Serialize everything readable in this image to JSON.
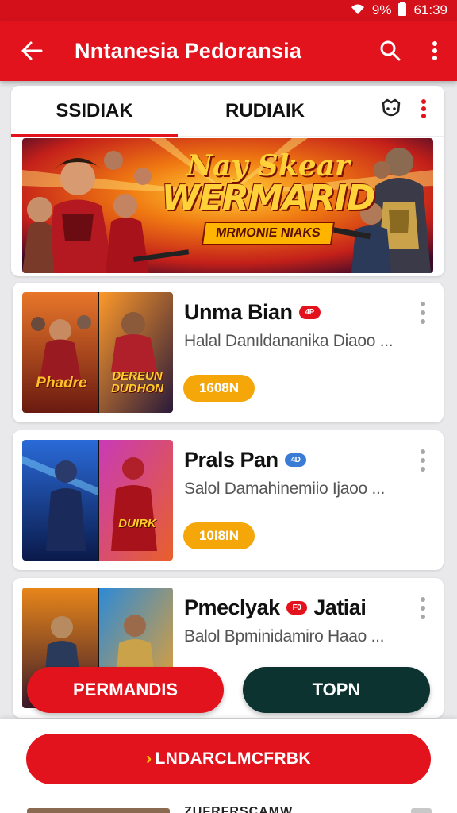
{
  "status_bar": {
    "battery": "9%",
    "time": "61:39"
  },
  "app_bar": {
    "title": "Nntanesia Pedoransia"
  },
  "tabs": [
    {
      "label": "SSIDIAK"
    },
    {
      "label": "RUDIAIK"
    }
  ],
  "banner": {
    "subtitle": "Nay Skear",
    "title": "WERMARID",
    "tagline": "MRMONIE NIAKS"
  },
  "games": [
    {
      "name": "Unma Bian",
      "badge": "4P",
      "badge_color": "#e3131e",
      "description": "Halal Danıldananika Diaoo ...",
      "price": "1608N",
      "thumb_right_label": "DEREUN DUDHON",
      "thumb_left_label": "Phadre"
    },
    {
      "name": "Prals Pan",
      "badge": "4D",
      "badge_color": "#3a7bd5",
      "description": "Salol Damahinemiio  Ijaoo ...",
      "price": "10I8IN",
      "thumb_right_label": "DUIRK",
      "thumb_left_label": ""
    },
    {
      "name": "Pmeclyak",
      "badge": "F0",
      "badge_color": "#e3131e",
      "name_suffix": "Jatiai",
      "description": "Balol Bpminidamiro Haao ...",
      "price": "",
      "thumb_right_label": "",
      "thumb_left_label": ""
    }
  ],
  "buttons": {
    "permandis": "PERMANDIS",
    "topn": "TOPN",
    "cta": "LNDARCLMCFRBK"
  },
  "peek": {
    "text": "ZUFRFRSCAMW"
  },
  "colors": {
    "brand_red": "#e3131e",
    "dark_teal": "#0c3330",
    "price_orange": "#f5a70a"
  },
  "icons": [
    "wifi-icon",
    "battery-icon",
    "back-arrow-icon",
    "search-icon",
    "more-vert-icon",
    "character-icon"
  ]
}
